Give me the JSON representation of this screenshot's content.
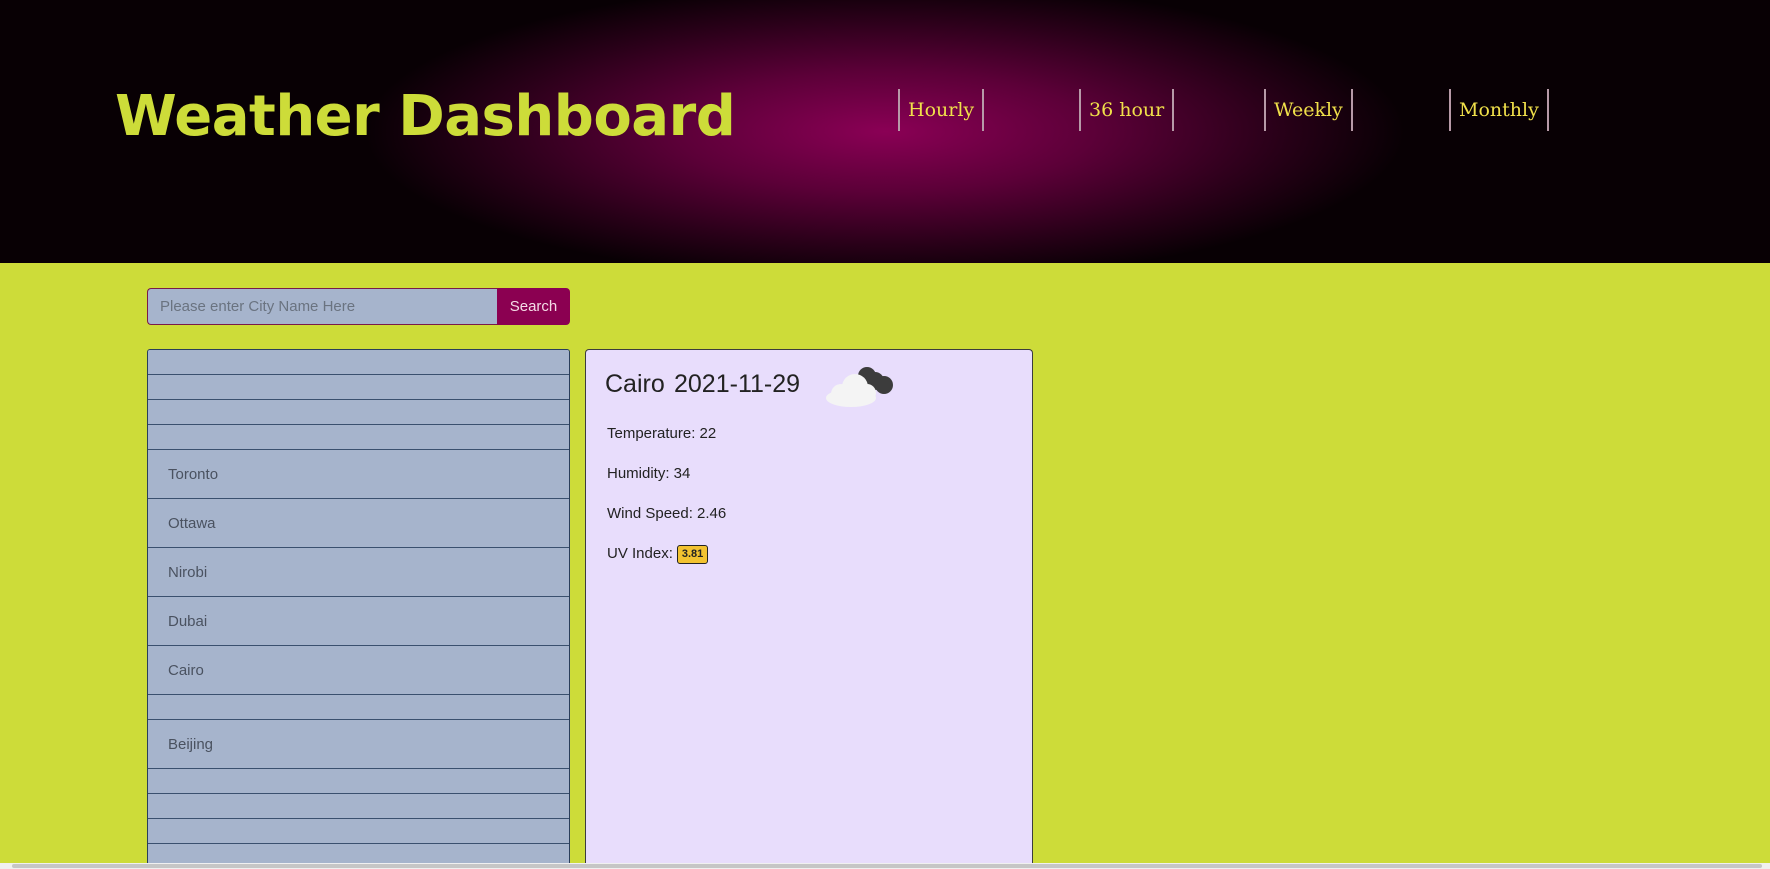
{
  "header": {
    "title": "Weather Dashboard",
    "nav": [
      "Hourly",
      "36 hour",
      "Weekly",
      "Monthly"
    ]
  },
  "search": {
    "placeholder": "Please enter City Name Here",
    "value": "",
    "button_label": "Search"
  },
  "city_list": [
    "",
    "",
    "",
    "",
    "Toronto",
    "Ottawa",
    "Nirobi",
    "Dubai",
    "Cairo",
    "",
    "Beijing",
    "",
    "",
    "",
    ""
  ],
  "weather": {
    "city": "Cairo",
    "date": "2021-11-29",
    "icon": "cloud-icon",
    "temperature_label": "Temperature: 22",
    "humidity_label": "Humidity: 34",
    "wind_label": "Wind Speed: 2.46",
    "uv_label": "UV Index:",
    "uv_value": "3.81"
  },
  "colors": {
    "page_bg": "#cddc39",
    "header_accent": "#8a0055",
    "title": "#cddc39",
    "nav_text": "#f0e04a",
    "search_button": "#8b0051",
    "list_bg": "#a6b4cc",
    "card_bg": "#e8ddfc",
    "uv_badge": "#f2c230"
  }
}
